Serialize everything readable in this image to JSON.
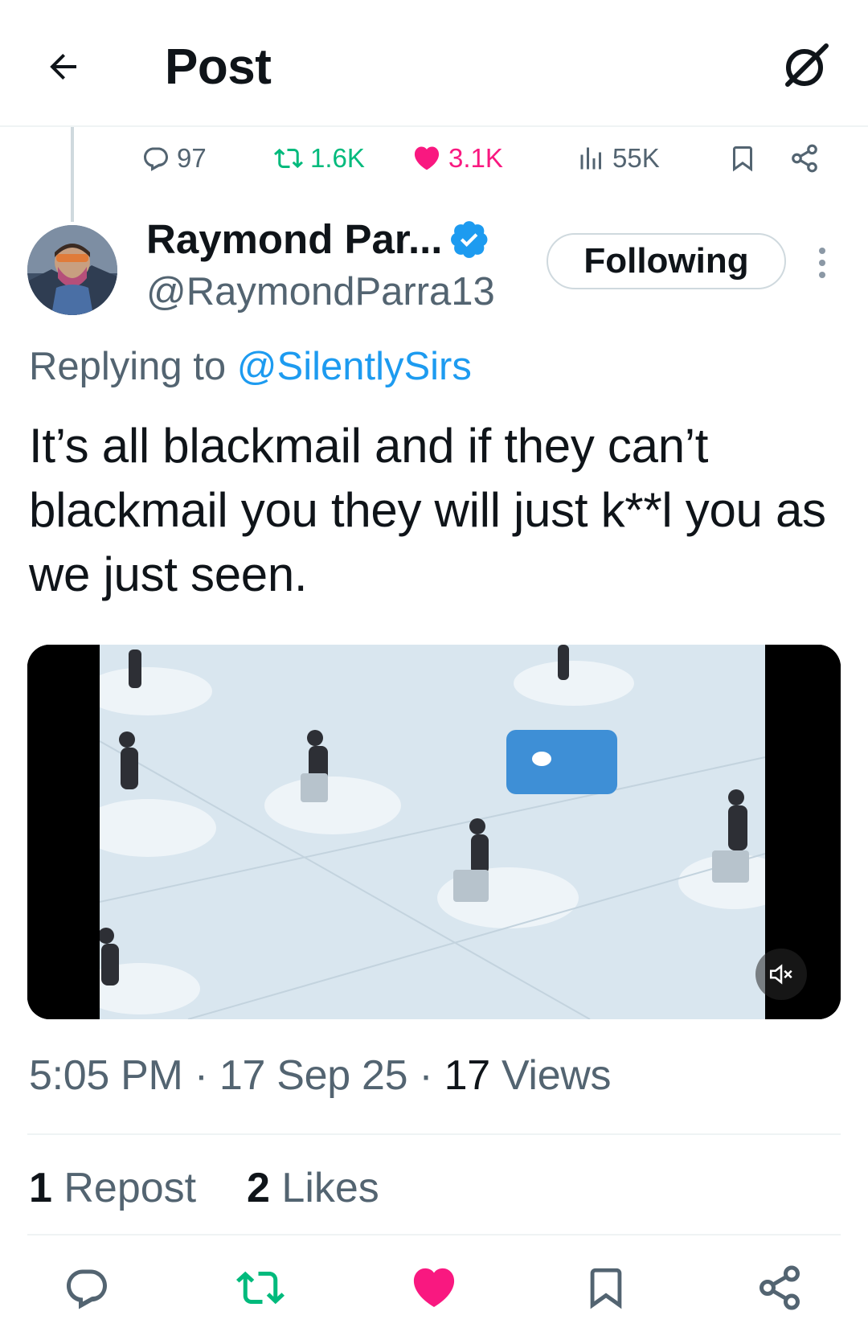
{
  "header": {
    "title": "Post",
    "back_icon": "arrow-left-icon",
    "grok_icon": "grok-icon"
  },
  "parent_post": {
    "replies": "97",
    "reposts": "1.6K",
    "likes": "3.1K",
    "views": "55K"
  },
  "author": {
    "name": "Raymond Par...",
    "handle": "@RaymondParra13",
    "verified": true,
    "follow_label": "Following"
  },
  "reply": {
    "prefix": "Replying to ",
    "target": "@SilentlySirs"
  },
  "post": {
    "text": "It’s all blackmail and if they can’t blackmail you they will just k**l you as we just seen.",
    "time": "5:05 PM",
    "sep1": " · ",
    "date": "17 Sep 25",
    "sep2": " · ",
    "views_count": "17",
    "views_label": " Views"
  },
  "stats": {
    "reposts_count": "1",
    "reposts_label": " Repost",
    "likes_count": "2",
    "likes_label": " Likes"
  },
  "colors": {
    "accent": "#1d9bf0",
    "like": "#f91880",
    "repost": "#00ba7c",
    "muted": "#536471"
  }
}
